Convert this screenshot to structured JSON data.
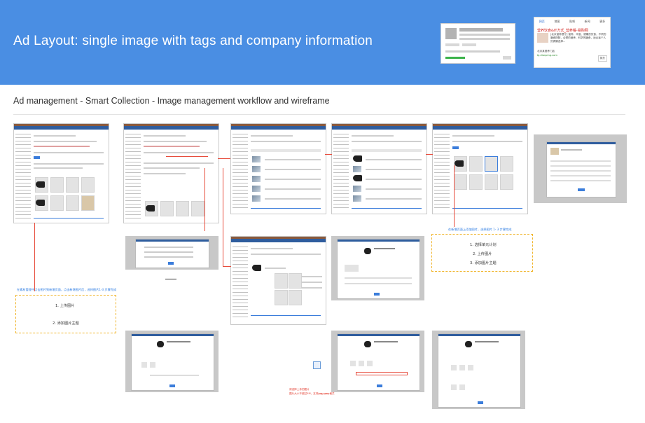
{
  "banner": {
    "title": "Ad Layout: single image with tags and company information",
    "sample_ad": {
      "nav": [
        "网页",
        "地图",
        "贴吧",
        "新闻",
        "更多"
      ],
      "headline": "营养饮食&IT方式_营养餐-易购网",
      "description": "[北京营养餐厅] 营养、丰富、健康的饮食，不同的膳食搭配，合理的营养，科学的膳食，适合每个人的健康选择...",
      "company": "北京某营养门店",
      "url": "bj.dianping.com",
      "call": "拨打"
    }
  },
  "section": {
    "title": "Ad management - Smart Collection - Image management workflow and wireframe"
  },
  "notes": {
    "flow_a": "在素材管理中点击图片到新增页面，点击新增图片后，选择图片1-3 步骤完成",
    "flow_b": "在新增页面上添加图片，选择图片 1- 3 步骤完成",
    "error_text": "请选择上传的图片",
    "error_detail": "图片大小不超过5M，支持jpg、png格式"
  },
  "steps_left": [
    "1.  上传图片",
    "2.  添加图片主题"
  ],
  "steps_right": [
    "1.  选择单元计划",
    "2.  上传图片",
    "3.  添加图片主题"
  ],
  "colors": {
    "banner": "#4a8ee3",
    "accent_blue": "#2a7ae2",
    "annotation_red": "#e74c3c",
    "step_border": "#f0b429"
  }
}
